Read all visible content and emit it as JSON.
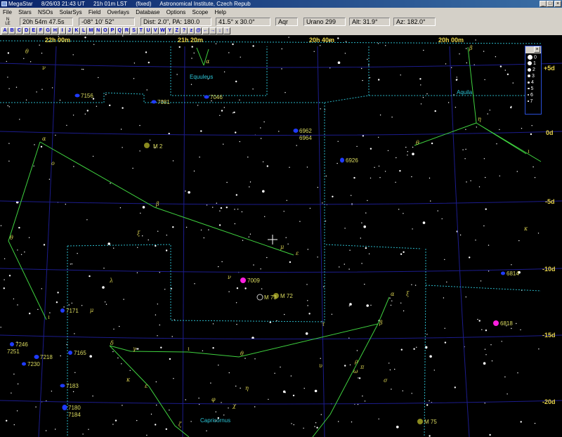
{
  "title_bar": {
    "app_name": "MegaStar",
    "datetime": "8/26/03 21:43 UT",
    "lst": "21h 01m LST",
    "mode": "(fixed)",
    "observatory": "Astronomical Institute, Czech Repub",
    "minimize": "_",
    "maximize": "□",
    "close": "×"
  },
  "menu": [
    "File",
    "Stars",
    "NSOs",
    "SolarSys",
    "Field",
    "Overlays",
    "Database",
    "Options",
    "Scope",
    "Help"
  ],
  "status": {
    "north_indicator": "N\nLE",
    "ra": "20h 54m 47.5s",
    "dec": "-08° 10' 52\"",
    "dist_pa": "Dist: 2.0\", PA: 180.0",
    "fov": "41.5° x 30.0°",
    "constellation": "Aqr",
    "atlas_page": "Urano 299",
    "altitude": "Alt: 31.9°",
    "azimuth": "Az: 182.0°"
  },
  "letter_buttons": [
    "A",
    "B",
    "C",
    "D",
    "E",
    "F",
    "G",
    "H",
    "I",
    "J",
    "K",
    "L",
    "M",
    "N",
    "O",
    "P",
    "Q",
    "R",
    "S",
    "T",
    "U",
    "V",
    "W",
    "Y",
    "Z",
    "?",
    "z",
    "@",
    "←",
    "→",
    "↓",
    "↑"
  ],
  "chart_labels": {
    "ra": [
      "22h 00m",
      "21h 20m",
      "20h 40m",
      "20h 00m"
    ],
    "dec": [
      "+5d",
      "0d",
      "-5d",
      "-10d",
      "-15d",
      "-20d"
    ],
    "constellations": [
      "Equuleus",
      "Aquila",
      "Capricornus"
    ],
    "objects": [
      {
        "name": "M 2",
        "kind": "globular"
      },
      {
        "name": "M 72",
        "kind": "globular"
      },
      {
        "name": "M 73",
        "kind": "open-cluster"
      },
      {
        "name": "M 75",
        "kind": "globular"
      },
      {
        "name": "7009",
        "kind": "planetary"
      },
      {
        "name": "6818",
        "kind": "planetary"
      },
      {
        "name": "7156",
        "kind": "galaxy"
      },
      {
        "name": "7081",
        "kind": "galaxy"
      },
      {
        "name": "7046",
        "kind": "galaxy"
      },
      {
        "name": "6962",
        "kind": "galaxy"
      },
      {
        "name": "6964",
        "kind": "galaxy"
      },
      {
        "name": "6926",
        "kind": "galaxy"
      },
      {
        "name": "6814",
        "kind": "galaxy"
      },
      {
        "name": "7171",
        "kind": "galaxy"
      },
      {
        "name": "7246",
        "kind": "galaxy"
      },
      {
        "name": "7251",
        "kind": "galaxy"
      },
      {
        "name": "7218",
        "kind": "galaxy"
      },
      {
        "name": "7230",
        "kind": "galaxy"
      },
      {
        "name": "7165",
        "kind": "galaxy"
      },
      {
        "name": "7183",
        "kind": "galaxy"
      },
      {
        "name": "7180",
        "kind": "galaxy"
      },
      {
        "name": "7184",
        "kind": "galaxy"
      }
    ],
    "greek_letters": [
      "θ",
      "ν",
      "α",
      "β",
      "θ",
      "η",
      "θ",
      "ι",
      "α",
      "ο",
      "β",
      "ξ",
      "μ",
      "ε",
      "ν",
      "λ",
      "μ",
      "ι",
      "κ",
      "τ",
      "β",
      "α",
      "ξ",
      "δ",
      "γ",
      "ι",
      "θ",
      "υ",
      "ρ",
      "π",
      "σ",
      "κ",
      "ε",
      "η",
      "φ",
      "χ",
      "ζ",
      "ω"
    ]
  },
  "mag_legend": {
    "close": "×",
    "levels": [
      "0",
      "1",
      "2",
      "3",
      "4",
      "5",
      "6",
      "7"
    ]
  },
  "colors": {
    "sky": "#000000",
    "constellation_lines": "#3fd23f",
    "boundaries": "#2ab7c7",
    "grid": "#1c1c8c",
    "galaxy": "#1f3bff",
    "planetary": "#ff1fe0",
    "globular": "#8a8a1e",
    "labels": "#e8d44a"
  }
}
